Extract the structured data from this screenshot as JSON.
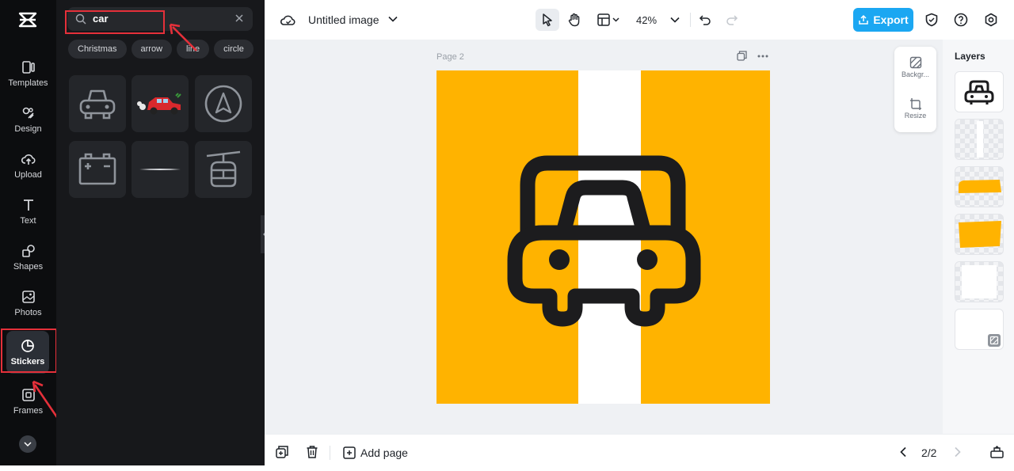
{
  "rail": {
    "items": [
      {
        "label": "Templates",
        "icon": "templates-icon"
      },
      {
        "label": "Design",
        "icon": "design-icon"
      },
      {
        "label": "Upload",
        "icon": "upload-icon"
      },
      {
        "label": "Text",
        "icon": "text-icon"
      },
      {
        "label": "Shapes",
        "icon": "shapes-icon"
      },
      {
        "label": "Photos",
        "icon": "photos-icon"
      },
      {
        "label": "Stickers",
        "icon": "stickers-icon",
        "active": true
      },
      {
        "label": "Frames",
        "icon": "frames-icon"
      }
    ]
  },
  "panel": {
    "search_value": "car",
    "chips": [
      "Christmas",
      "arrow",
      "line",
      "circle"
    ],
    "stickers": [
      "car-outline-sticker",
      "red-car-sticker",
      "navigation-arrow-sticker",
      "battery-sticker",
      "line-sticker",
      "cable-car-sticker"
    ]
  },
  "topbar": {
    "title": "Untitled image",
    "zoom": "42%",
    "export_label": "Export"
  },
  "canvas": {
    "page_label": "Page 2",
    "background_tool": "Backgr...",
    "resize_tool": "Resize",
    "colors": {
      "yellow": "#ffb300",
      "stripe": "#ffffff",
      "icon": "#1c1c1e"
    }
  },
  "layers": {
    "title": "Layers",
    "items": [
      "car-icon-layer",
      "white-stripe-layer",
      "yellow-shape-layer-1",
      "yellow-shape-layer-2",
      "white-rect-layer",
      "background-layer"
    ]
  },
  "bottombar": {
    "add_page_label": "Add page",
    "pagination": "2/2"
  },
  "colors": {
    "accent": "#1ba7f2",
    "annotation": "#e5303a"
  }
}
